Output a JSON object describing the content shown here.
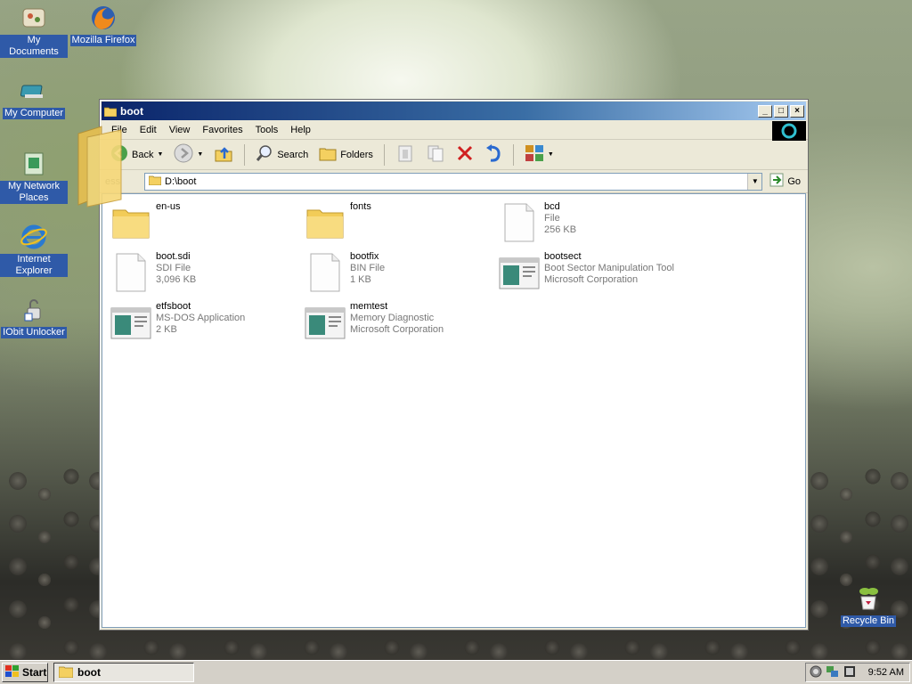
{
  "desktop": {
    "icons": [
      {
        "label": "My Documents"
      },
      {
        "label": "Mozilla Firefox"
      },
      {
        "label": "My Computer"
      },
      {
        "label": "My Network Places"
      },
      {
        "label": "Internet Explorer"
      },
      {
        "label": "IObit Unlocker"
      },
      {
        "label": "Recycle Bin"
      }
    ]
  },
  "window": {
    "title": "boot",
    "menu": [
      "File",
      "Edit",
      "View",
      "Favorites",
      "Tools",
      "Help"
    ],
    "toolbar": {
      "back": "Back",
      "search": "Search",
      "folders": "Folders"
    },
    "address": {
      "label": "ess",
      "value": "D:\\boot",
      "go": "Go"
    },
    "files": [
      {
        "name": "en-us",
        "type": "",
        "detail": "",
        "icon": "folder-icon"
      },
      {
        "name": "fonts",
        "type": "",
        "detail": "",
        "icon": "folder-icon"
      },
      {
        "name": "bcd",
        "type": "File",
        "detail": "256 KB",
        "icon": "file-icon"
      },
      {
        "name": "boot.sdi",
        "type": "SDI File",
        "detail": "3,096 KB",
        "icon": "file-icon"
      },
      {
        "name": "bootfix",
        "type": "BIN File",
        "detail": "1 KB",
        "icon": "file-icon"
      },
      {
        "name": "bootsect",
        "type": "Boot Sector Manipulation Tool",
        "detail": "Microsoft Corporation",
        "icon": "app-icon"
      },
      {
        "name": "etfsboot",
        "type": "MS-DOS Application",
        "detail": "2 KB",
        "icon": "app-icon"
      },
      {
        "name": "memtest",
        "type": "Memory Diagnostic",
        "detail": "Microsoft Corporation",
        "icon": "app-icon"
      }
    ]
  },
  "taskbar": {
    "start": "Start",
    "task": "boot",
    "clock": "9:52 AM"
  }
}
